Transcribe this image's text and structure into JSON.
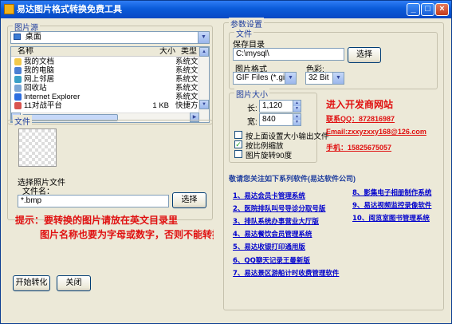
{
  "window": {
    "title": "易达图片格式转换免费工具"
  },
  "titlebar_buttons": {
    "minimize": "_",
    "maximize": "□",
    "close": "×"
  },
  "left": {
    "source_group": "图片源",
    "drive_combo": "桌面",
    "list_headers": {
      "name": "名称",
      "size": "大小",
      "type": "类型"
    },
    "files": [
      {
        "name": "我的文档",
        "size": "",
        "type": "系统文",
        "icon": "folder-icon"
      },
      {
        "name": "我的电脑",
        "size": "",
        "type": "系统文",
        "icon": "computer-icon"
      },
      {
        "name": "网上邻居",
        "size": "",
        "type": "系统文",
        "icon": "network-icon"
      },
      {
        "name": "回收站",
        "size": "",
        "type": "系统文",
        "icon": "recycle-bin-icon"
      },
      {
        "name": "Internet Explorer",
        "size": "",
        "type": "系统文",
        "icon": "ie-icon"
      },
      {
        "name": "11对战平台",
        "size": "1 KB",
        "type": "快捷方",
        "icon": "shortcut-icon"
      }
    ],
    "file_group": "文件",
    "select_photo_file": "选择照片文件",
    "file_name_label": "文件名：",
    "file_name_value": "*.bmp",
    "select_button": "选择",
    "hint_line1": "提示：要转换的图片请放在英文目录里",
    "hint_line2": "图片名称也要为字母或数字，否则不能转换(",
    "start_button": "开始转化",
    "close_button": "关闭"
  },
  "settings": {
    "group": "参数设置",
    "file_group": "文件",
    "save_dir_label": "保存目录",
    "save_dir_value": "C:\\mysql\\",
    "select_button": "选择",
    "format_label": "图片格式",
    "format_value": "GIF Files (*.gif)",
    "color_label": "色彩:",
    "color_value": "32 Bit",
    "size_group": "图片大小",
    "length_label": "长:",
    "length_value": "1,120",
    "width_label": "宽:",
    "width_value": "840",
    "options": [
      {
        "label": "按上面设置大小输出文件",
        "checked": false
      },
      {
        "label": "按比例缩放",
        "checked": true
      },
      {
        "label": "图片旋转90度",
        "checked": false
      }
    ]
  },
  "promo": {
    "enter_site": "进入开发商网站",
    "qq": "联系QQ：872816987",
    "email": "Email:zxxyzxxy168@126.com",
    "phone": "手机：15825675057"
  },
  "software": {
    "heading": "敬请您关注如下系列软件(易达软件公司)",
    "left_col": [
      "1、易达会员卡管理系统",
      "2、医院排队叫号导诊分取号版",
      "3、排队系统办事营业大厅版",
      "4、易达餐饮会员管理系统",
      "5、易达收银打印通用版",
      "6、QQ聊天记录王曼新版",
      "7、易达景区游船计时收费管理软件"
    ],
    "right_col": [
      "8、影集电子相册制作系统",
      "9、易达视频监控录像软件",
      "10、阅览室图书管理系统"
    ]
  },
  "colors": {
    "accent": "#0a5bd9",
    "hint": "#e01010",
    "link": "#0000cc"
  }
}
